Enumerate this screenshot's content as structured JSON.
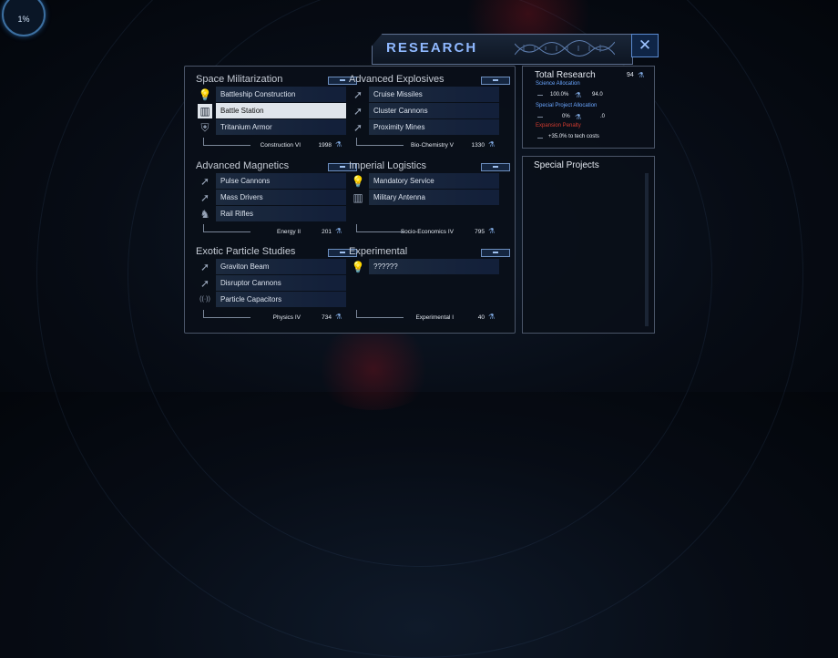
{
  "progress": {
    "label": "1%"
  },
  "window": {
    "title": "RESEARCH",
    "close_glyph": "✕"
  },
  "groups": [
    {
      "title": "Space Militarization",
      "techs": [
        {
          "label": "Battleship Construction",
          "icon": "lightbulb-icon"
        },
        {
          "label": "Battle Station",
          "icon": "factory-icon",
          "selected": true
        },
        {
          "label": "Tritanium Armor",
          "icon": "shield-icon"
        }
      ],
      "field": "Construction VI",
      "points": "1998"
    },
    {
      "title": "Advanced Explosives",
      "techs": [
        {
          "label": "Cruise Missiles",
          "icon": "missile-icon"
        },
        {
          "label": "Cluster Cannons",
          "icon": "missile-icon"
        },
        {
          "label": "Proximity Mines",
          "icon": "missile-icon"
        }
      ],
      "field": "Bio-Chemistry V",
      "points": "1330"
    },
    {
      "title": "Advanced Magnetics",
      "techs": [
        {
          "label": "Pulse Cannons",
          "icon": "missile-icon"
        },
        {
          "label": "Mass Drivers",
          "icon": "missile-icon"
        },
        {
          "label": "Rail Rifles",
          "icon": "soldier-icon"
        }
      ],
      "field": "Energy II",
      "points": "201"
    },
    {
      "title": "Imperial Logistics",
      "techs": [
        {
          "label": "Mandatory Service",
          "icon": "lightbulb-icon"
        },
        {
          "label": "Military Antenna",
          "icon": "factory-icon"
        }
      ],
      "field": "Socio-Economics IV",
      "points": "795"
    },
    {
      "title": "Exotic Particle Studies",
      "techs": [
        {
          "label": "Graviton Beam",
          "icon": "missile-icon"
        },
        {
          "label": "Disruptor Cannons",
          "icon": "missile-icon"
        },
        {
          "label": "Particle Capacitors",
          "icon": "antenna-icon"
        }
      ],
      "field": "Physics IV",
      "points": "734"
    },
    {
      "title": "Experimental",
      "techs": [
        {
          "label": "??????",
          "icon": "lightbulb-icon"
        }
      ],
      "field": "Experimental I",
      "points": "40"
    }
  ],
  "total_research": {
    "title": "Total Research",
    "value": "94",
    "science_allocation_label": "Science Allocation",
    "science_pct": "100.0%",
    "science_value": "94.0",
    "special_allocation_label": "Special Project Allocation",
    "special_pct": "0%",
    "special_value": ".0",
    "penalty_label": "Expansion Penalty",
    "penalty_value": "+35.0% to tech costs"
  },
  "special_projects": {
    "title": "Special Projects"
  },
  "colors": {
    "accent": "#8fb8ff",
    "penalty": "#d23b2f",
    "science_label": "#6aa6ff"
  }
}
